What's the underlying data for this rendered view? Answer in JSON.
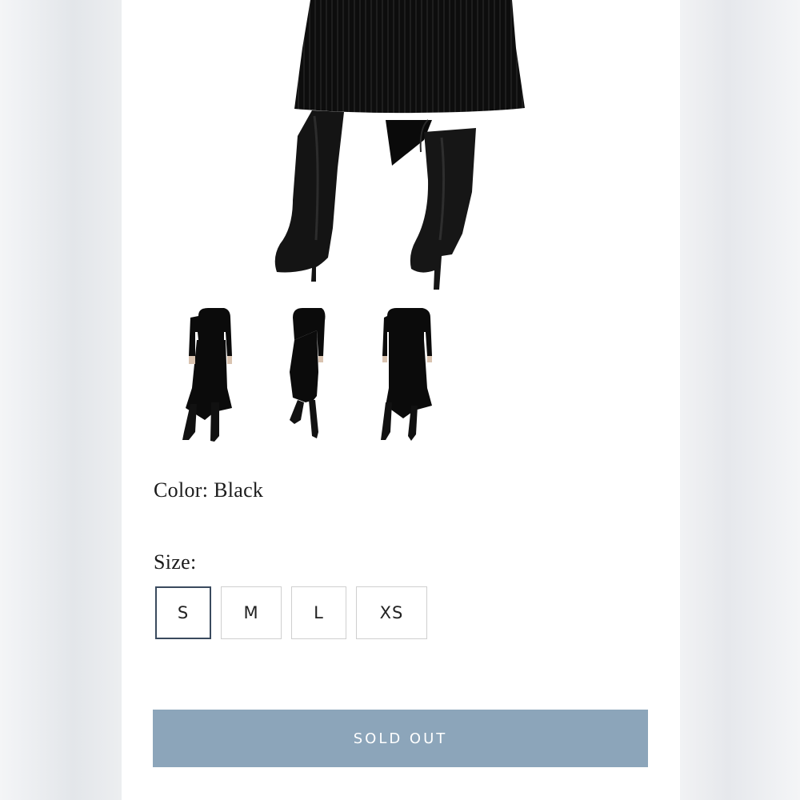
{
  "product": {
    "color_label": "Color:",
    "color_value": "Black",
    "size_label": "Size:",
    "sizes": [
      "S",
      "M",
      "L",
      "XS"
    ],
    "selected_size": "S",
    "cta_label": "SOLD OUT",
    "thumbnails": [
      "skirt-front-view",
      "skirt-side-view",
      "skirt-back-view"
    ]
  },
  "colors": {
    "cta_background": "#8ca5ba",
    "selected_border": "#3a4a5e",
    "garment": "#0b0b0b"
  }
}
